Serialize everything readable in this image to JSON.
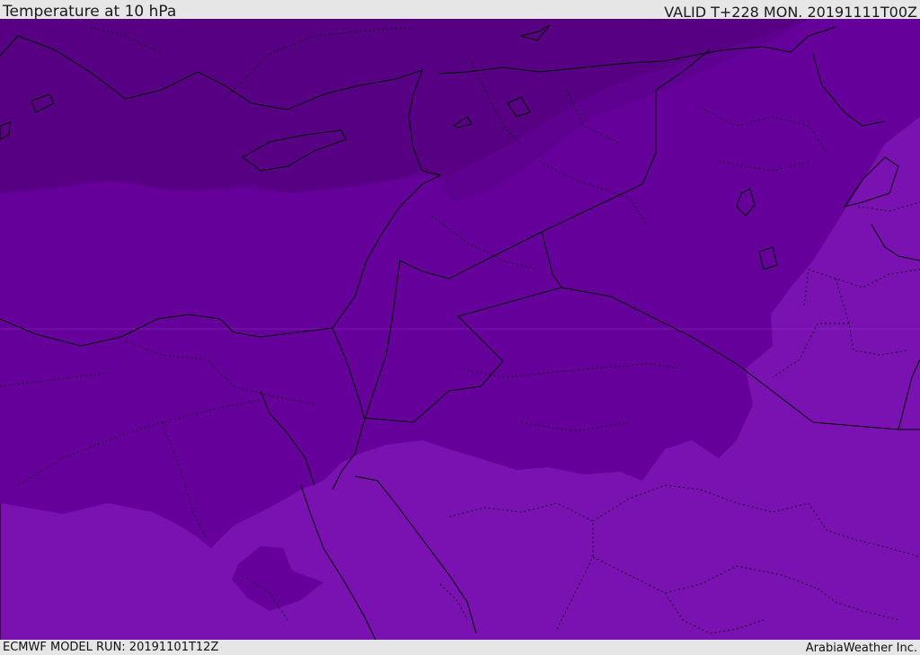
{
  "header": {
    "title": "Temperature at 10 hPa",
    "valid": "VALID T+228 MON. 20191111T00Z"
  },
  "footer": {
    "model_run": "ECMWF MODEL RUN: 20191101T12Z",
    "brand": "ArabiaWeather Inc."
  },
  "map": {
    "colors": {
      "darkest": "#55007c",
      "dark": "#5e0090",
      "mid": "#66009a",
      "light": "#7a12b2",
      "border": "#000000"
    }
  }
}
